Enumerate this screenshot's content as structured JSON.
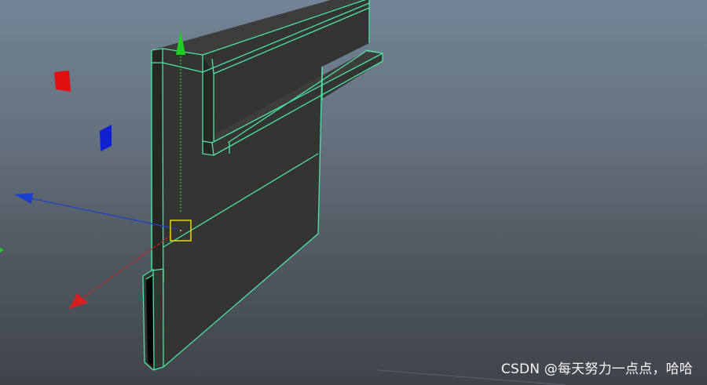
{
  "viewport": {
    "background_top": "#738497",
    "background_bottom": "#3f4449"
  },
  "model": {
    "face_color": "#333333",
    "edge_color": "#4de3a0",
    "selected": true
  },
  "manipulator": {
    "x_axis_color": "#d42020",
    "y_axis_color": "#22cc22",
    "z_axis_color": "#1a3fcc",
    "pivot_color": "#e8d80a"
  },
  "view_cube": {
    "red_face": "#e01010",
    "blue_face": "#1020d0"
  },
  "watermark": {
    "text": "CSDN @每天努力一点点，哈哈"
  }
}
